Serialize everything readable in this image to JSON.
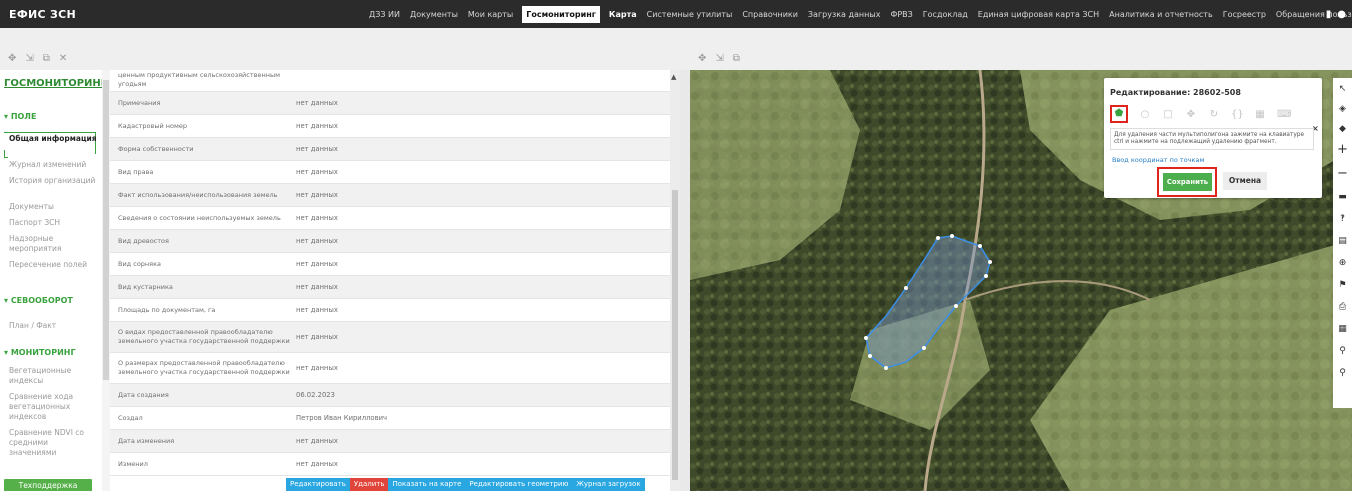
{
  "topbar": {
    "brand": "ЕФИС ЗСН",
    "nav": [
      "ДЗЗ ИИ",
      "Документы",
      "Мои карты",
      "Госмониторинг",
      "Карта",
      "Системные утилиты",
      "Справочники",
      "Загрузка данных",
      "ФРВЗ",
      "Госдоклад",
      "Единая цифровая карта ЗСН",
      "Аналитика и отчетность",
      "Госреестр",
      "Обращения пользователей"
    ]
  },
  "sidebar": {
    "title": "ГОСМОНИТОРИНГ",
    "section_field": "ПОЛЕ",
    "items_field": [
      "Общая информация",
      "Журнал изменений",
      "История организаций",
      "Документы",
      "Паспорт ЗСН",
      "Надзорные мероприятия",
      "Пересечение полей"
    ],
    "section_rotation": "СЕВООБОРОТ",
    "items_rotation": [
      "План / Факт"
    ],
    "section_monitoring": "МОНИТОРИНГ",
    "items_monitoring": [
      "Вегетационные индексы",
      "Сравнение хода вегетационных индексов",
      "Сравнение NDVI со средними значениями"
    ],
    "support": "Техподдержка"
  },
  "table": {
    "rows": [
      {
        "label": "ценным продуктивным сельскохозяйственным угодьям",
        "value": ""
      },
      {
        "label": "Примечания",
        "value": "нет данных"
      },
      {
        "label": "Кадастровый номер",
        "value": "нет данных"
      },
      {
        "label": "Форма собственности",
        "value": "нет данных"
      },
      {
        "label": "Вид права",
        "value": "нет данных"
      },
      {
        "label": "Факт использования/неиспользования земель",
        "value": "нет данных"
      },
      {
        "label": "Сведения о состоянии неиспользуемых земель",
        "value": "нет данных"
      },
      {
        "label": "Вид древостоя",
        "value": "нет данных"
      },
      {
        "label": "Вид сорняка",
        "value": "нет данных"
      },
      {
        "label": "Вид кустарника",
        "value": "нет данных"
      },
      {
        "label": "Площадь по документам, га",
        "value": "нет данных"
      },
      {
        "label": "О видах предоставленной правообладателю земельного участка государственной поддержки",
        "value": "нет данных"
      },
      {
        "label": "О размерах предоставленной правообладателю земельного участка государственной поддержки",
        "value": "нет данных"
      },
      {
        "label": "Дата создания",
        "value": "06.02.2023"
      },
      {
        "label": "Создал",
        "value": "Петров Иван Кириллович"
      },
      {
        "label": "Дата изменения",
        "value": "нет данных"
      },
      {
        "label": "Изменил",
        "value": "нет данных"
      }
    ]
  },
  "actions": {
    "edit": "Редактировать",
    "delete": "Удалить",
    "show_on_map": "Показать на карте",
    "edit_geometry": "Редактировать геометрию",
    "upload_log": "Журнал загрузок"
  },
  "edit_popup": {
    "title": "Редактирование: 28602-508",
    "hint": "Для удаления части мультиполигона зажмите на клавиатуре ctrl и нажмите на подлежащий удалению фрагмент.",
    "coord_link": "Ввод координат по точкам",
    "save": "Сохранить",
    "cancel": "Отмена",
    "close": "×"
  },
  "colors": {
    "accent_green": "#3aa23f",
    "highlight_red": "#e0231b",
    "action_blue": "#2aa7e0",
    "delete_red": "#e0443a",
    "polygon_blue": "#3b8fe8"
  },
  "icons": [
    "pentagon-icon",
    "circle-icon",
    "square-icon",
    "move-icon",
    "rotate-icon",
    "code-icon",
    "trash-icon"
  ]
}
